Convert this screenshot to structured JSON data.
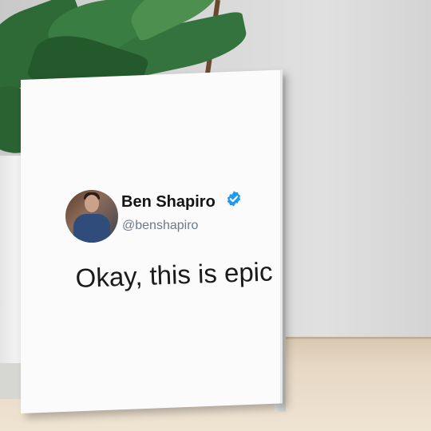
{
  "tweet": {
    "display_name": "Ben Shapiro",
    "handle": "@benshapiro",
    "text": "Okay, this is epic",
    "verified": true,
    "verified_color": "#1d9bf0"
  },
  "icons": {
    "verified": "verified-badge-icon",
    "avatar": "profile-photo"
  }
}
